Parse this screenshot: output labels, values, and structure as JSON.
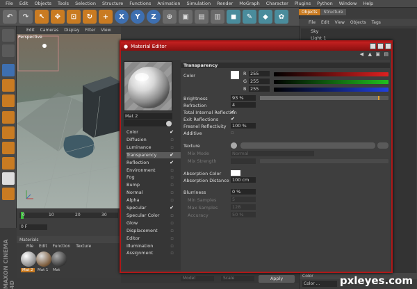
{
  "app": {
    "menu": [
      "File",
      "Edit",
      "Objects",
      "Tools",
      "Selection",
      "Structure",
      "Functions",
      "Animation",
      "Simulation",
      "Render",
      "MoGraph",
      "Character",
      "Plugins",
      "Python",
      "Window",
      "Help"
    ],
    "toolbar_icons": [
      {
        "name": "undo-icon",
        "glyph": "↶",
        "style": "g"
      },
      {
        "name": "redo-icon",
        "glyph": "↷",
        "style": "g"
      },
      {
        "name": "select-icon",
        "glyph": "↖",
        "style": "o"
      },
      {
        "name": "move-icon",
        "glyph": "✥",
        "style": "o"
      },
      {
        "name": "scale-icon",
        "glyph": "⊡",
        "style": "o"
      },
      {
        "name": "rotate-icon",
        "glyph": "↻",
        "style": "o"
      },
      {
        "name": "plus-icon",
        "glyph": "+",
        "style": "o"
      },
      {
        "name": "x-axis-icon",
        "glyph": "X",
        "style": "b"
      },
      {
        "name": "y-axis-icon",
        "glyph": "Y",
        "style": "b"
      },
      {
        "name": "z-axis-icon",
        "glyph": "Z",
        "style": "b"
      },
      {
        "name": "coord-icon",
        "glyph": "⊕",
        "style": "g"
      },
      {
        "name": "render-view-icon",
        "glyph": "▣",
        "style": "g"
      },
      {
        "name": "render-picture-icon",
        "glyph": "▤",
        "style": "g"
      },
      {
        "name": "render-settings-icon",
        "glyph": "▥",
        "style": "g"
      },
      {
        "name": "cube-icon",
        "glyph": "◼",
        "style": "c"
      },
      {
        "name": "pen-icon",
        "glyph": "✎",
        "style": "c"
      },
      {
        "name": "subdivide-icon",
        "glyph": "◆",
        "style": "c"
      },
      {
        "name": "array-icon",
        "glyph": "✿",
        "style": "c"
      }
    ]
  },
  "right_panel": {
    "tabs": [
      "Objects",
      "Structure"
    ],
    "menu": [
      "File",
      "Edit",
      "View",
      "Objects",
      "Tags"
    ],
    "items": [
      "Sky",
      "Light 1"
    ],
    "color_label": "Color",
    "color_field": "Color ..."
  },
  "viewport": {
    "menu": [
      "Edit",
      "Cameras",
      "Display",
      "Filter",
      "View"
    ],
    "label": "Perspective"
  },
  "timeline": {
    "ticks": [
      "0",
      "10",
      "20",
      "30"
    ],
    "frame": "0 F"
  },
  "materials": {
    "title": "Materials",
    "menu": [
      "File",
      "Edit",
      "Function",
      "Texture"
    ],
    "items": [
      "Mat 2",
      "Mat 1",
      "Mat"
    ]
  },
  "branding": "MAXON CINEMA 4D",
  "dialog": {
    "title": "Material Editor",
    "material_name": "Mat 2",
    "channels": [
      {
        "label": "Color",
        "checked": true
      },
      {
        "label": "Diffusion",
        "checked": false
      },
      {
        "label": "Luminance",
        "checked": false
      },
      {
        "label": "Transparency",
        "checked": true,
        "selected": true
      },
      {
        "label": "Reflection",
        "checked": true
      },
      {
        "label": "Environment",
        "checked": false
      },
      {
        "label": "Fog",
        "checked": false
      },
      {
        "label": "Bump",
        "checked": false
      },
      {
        "label": "Normal",
        "checked": false
      },
      {
        "label": "Alpha",
        "checked": false
      },
      {
        "label": "Specular",
        "checked": true
      },
      {
        "label": "Specular Color",
        "checked": false
      },
      {
        "label": "Glow",
        "checked": false
      },
      {
        "label": "Displacement",
        "checked": false
      },
      {
        "label": "Editor",
        "checked": false
      },
      {
        "label": "Illumination",
        "checked": false
      },
      {
        "label": "Assignment",
        "checked": false
      }
    ],
    "section": "Transparency",
    "color_label": "Color",
    "r_label": "R",
    "g_label": "G",
    "b_label": "B",
    "r_value": "255",
    "g_value": "255",
    "b_value": "255",
    "brightness_label": "Brightness",
    "brightness_value": "93 %",
    "brightness_fraction": 0.93,
    "refraction_label": "Refraction",
    "refraction_value": "4",
    "tir_label": "Total Internal Reflection",
    "tir_checked": true,
    "exit_label": "Exit Reflections",
    "exit_checked": true,
    "fresnel_label": "Fresnel Reflectivity",
    "fresnel_value": "100 %",
    "additive_label": "Additive",
    "additive_checked": false,
    "texture_label": "Texture",
    "mixmode_label": "Mix Mode",
    "mixmode_value": "Normal",
    "mixstrength_label": "Mix Strength",
    "absorption_color_label": "Absorption Color",
    "absorption_distance_label": "Absorption Distance",
    "absorption_distance_value": "100 cm",
    "blurriness_label": "Blurriness",
    "blurriness_value": "0 %",
    "min_samples_label": "Min Samples",
    "min_samples_value": "5",
    "max_samples_label": "Max Samples",
    "max_samples_value": "128",
    "accuracy_label": "Accuracy",
    "accuracy_value": "50 %",
    "apply_label": "Apply"
  },
  "bottom_fields": [
    "Model",
    "Scale"
  ],
  "watermark": "pxleyes.com",
  "colors": {
    "accent": "#c97b22",
    "dialog_border": "#b01818"
  }
}
